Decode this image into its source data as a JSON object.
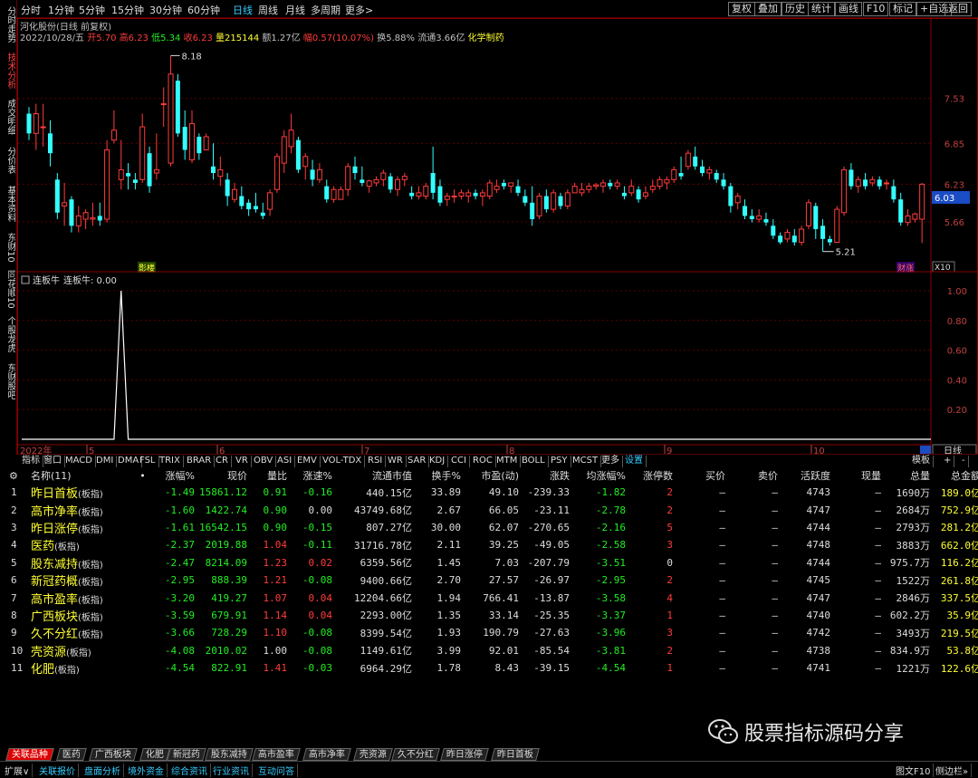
{
  "left_tabs": [
    "分时走势",
    "技术分析",
    "成交明细",
    "分价表",
    "基本资料",
    "东财10",
    "同花顺10",
    "个股龙虎",
    "东财股吧"
  ],
  "left_active": 1,
  "periods": [
    "分时",
    "1分钟",
    "5分钟",
    "15分钟",
    "30分钟",
    "60分钟",
    "日线",
    "周线",
    "月线",
    "多周期",
    "更多>"
  ],
  "period_active": 6,
  "right_buttons": [
    "复权",
    "叠加",
    "历史",
    "统计",
    "画线",
    "F10",
    "标记",
    "+自选",
    "返回"
  ],
  "info": {
    "name": "河化股份(日线 前复权)",
    "date": "2022/10/28/五",
    "open_label": "开",
    "open": "5.70",
    "high_label": "高",
    "high": "6.23",
    "low_label": "低",
    "low": "5.34",
    "close_label": "收",
    "close": "6.23",
    "vol_label": "量",
    "vol": "215144",
    "amt_label": "额",
    "amt": "1.27亿",
    "chg_label": "幅",
    "chg": "0.57(10.07%)",
    "turn_label": "换",
    "turn": "5.88%",
    "float_label": "流通",
    "float": "3.66亿",
    "concept": "化学制药"
  },
  "price_axis": [
    "7.53",
    "6.85",
    "6.23",
    "5.66"
  ],
  "price_current": "6.03",
  "high_mark": "8.18",
  "low_mark": "5.21",
  "tag_left": "影楼",
  "tag_right": "财涨",
  "zoom": "X10",
  "indicator": {
    "title": "连板牛",
    "value_text": "连板牛: 0.00",
    "axis": [
      "1.00",
      "0.80",
      "0.60",
      "0.40",
      "0.20"
    ]
  },
  "x_axis": [
    "2022年",
    "5",
    "6",
    "7",
    "8",
    "9",
    "10"
  ],
  "day_tab": "日线",
  "idx_tabs": [
    "指标",
    "窗口",
    "MACD",
    "DMI",
    "DMA",
    "FSL",
    "TRIX",
    "BRAR",
    "CR",
    "VR",
    "OBV",
    "ASI",
    "EMV",
    "VOL-TDX",
    "RSI",
    "WR",
    "SAR",
    "KDJ",
    "CCI",
    "ROC",
    "MTM",
    "BOLL",
    "PSY",
    "MCST",
    "更多",
    "设置"
  ],
  "idx_right": [
    "模板",
    "+",
    "-"
  ],
  "table": {
    "headers": [
      "名称(11)",
      "•",
      "涨幅%",
      "现价",
      "量比",
      "涨速%",
      "流通市值",
      "换手%",
      "市盈(动)",
      "涨跌",
      "均涨幅%",
      "涨停数",
      "买价",
      "卖价",
      "活跃度",
      "现量",
      "总量",
      "总金额"
    ],
    "rows": [
      [
        "1",
        "昨日首板",
        "-1.49",
        "15861.12",
        "0.91",
        "-0.16",
        "440.15亿",
        "33.89",
        "49.10",
        "-239.33",
        "-1.82",
        "2",
        "—",
        "—",
        "4743",
        "—",
        "1690万",
        "189.0亿"
      ],
      [
        "2",
        "高市净率",
        "-1.60",
        "1422.74",
        "0.90",
        "0.00",
        "43749.68亿",
        "2.67",
        "66.05",
        "-23.11",
        "-2.78",
        "2",
        "—",
        "—",
        "4747",
        "—",
        "2684万",
        "752.9亿"
      ],
      [
        "3",
        "昨日涨停",
        "-1.61",
        "16542.15",
        "0.90",
        "-0.15",
        "807.27亿",
        "30.00",
        "62.07",
        "-270.65",
        "-2.16",
        "5",
        "—",
        "—",
        "4744",
        "—",
        "2793万",
        "281.2亿"
      ],
      [
        "4",
        "医药",
        "-2.37",
        "2019.88",
        "1.04",
        "-0.11",
        "31716.78亿",
        "2.11",
        "39.25",
        "-49.05",
        "-2.58",
        "3",
        "—",
        "—",
        "4748",
        "—",
        "3883万",
        "662.0亿"
      ],
      [
        "5",
        "股东减持",
        "-2.47",
        "8214.09",
        "1.23",
        "0.02",
        "6359.56亿",
        "1.45",
        "7.03",
        "-207.79",
        "-3.51",
        "0",
        "—",
        "—",
        "4744",
        "—",
        "975.7万",
        "116.2亿"
      ],
      [
        "6",
        "新冠药概",
        "-2.95",
        "888.39",
        "1.21",
        "-0.08",
        "9400.66亿",
        "2.70",
        "27.57",
        "-26.97",
        "-2.95",
        "2",
        "—",
        "—",
        "4745",
        "—",
        "1522万",
        "261.8亿"
      ],
      [
        "7",
        "高市盈率",
        "-3.20",
        "419.27",
        "1.07",
        "0.04",
        "12204.66亿",
        "1.94",
        "766.41",
        "-13.87",
        "-3.58",
        "4",
        "—",
        "—",
        "4747",
        "—",
        "2846万",
        "337.5亿"
      ],
      [
        "8",
        "广西板块",
        "-3.59",
        "679.91",
        "1.14",
        "0.04",
        "2293.00亿",
        "1.35",
        "33.14",
        "-25.35",
        "-3.37",
        "1",
        "—",
        "—",
        "4740",
        "—",
        "602.2万",
        "35.9亿"
      ],
      [
        "9",
        "久不分红",
        "-3.66",
        "728.29",
        "1.10",
        "-0.08",
        "8399.54亿",
        "1.93",
        "190.79",
        "-27.63",
        "-3.96",
        "3",
        "—",
        "—",
        "4742",
        "—",
        "3493万",
        "219.5亿"
      ],
      [
        "10",
        "壳资源",
        "-4.08",
        "2010.02",
        "1.00",
        "-0.08",
        "1149.61亿",
        "3.99",
        "92.01",
        "-85.54",
        "-3.81",
        "2",
        "—",
        "—",
        "4738",
        "—",
        "834.9万",
        "53.8亿"
      ],
      [
        "11",
        "化肥",
        "-4.54",
        "822.91",
        "1.41",
        "-0.03",
        "6964.29亿",
        "1.78",
        "8.43",
        "-39.15",
        "-4.54",
        "1",
        "—",
        "—",
        "4741",
        "—",
        "1221万",
        "122.6亿"
      ]
    ],
    "suffix": "(板指)"
  },
  "bottom_tabs": [
    "关联品种",
    "医药",
    "广西板块",
    "化肥",
    "新冠药",
    "股东减持",
    "高市盈率",
    "高市净率",
    "壳资源",
    "久不分红",
    "昨日涨停",
    "昨日首板"
  ],
  "status_items": [
    "扩展∨",
    "关联报价",
    "盘面分析",
    "境外资金",
    "综合资讯",
    "行业资讯",
    "互动问答"
  ],
  "status_right": [
    "图文F10",
    "侧边栏»"
  ],
  "watermark": "股票指标源码分享",
  "colors": {
    "up": "#ff3b3b",
    "down": "#33ffff",
    "bg": "#000000",
    "accent": "#33ccff"
  },
  "chart_data": {
    "type": "candlestick",
    "ohlc": [
      [
        7.3,
        7.4,
        6.9,
        7.0
      ],
      [
        7.0,
        7.45,
        6.75,
        7.3
      ],
      [
        7.1,
        7.45,
        6.8,
        7.1
      ],
      [
        7.0,
        7.2,
        6.5,
        6.7
      ],
      [
        6.3,
        6.4,
        5.7,
        5.8
      ],
      [
        5.9,
        6.25,
        5.6,
        5.95
      ],
      [
        6.0,
        6.05,
        5.5,
        5.6
      ],
      [
        5.6,
        5.9,
        5.5,
        5.75
      ],
      [
        5.7,
        5.85,
        5.55,
        5.8
      ],
      [
        5.7,
        5.95,
        5.6,
        5.72
      ],
      [
        5.75,
        5.95,
        5.6,
        5.68
      ],
      [
        5.7,
        6.9,
        5.65,
        6.75
      ],
      [
        6.9,
        7.35,
        6.85,
        7.05
      ],
      [
        6.3,
        6.9,
        6.15,
        6.45
      ],
      [
        6.4,
        6.55,
        6.15,
        6.35
      ],
      [
        6.3,
        6.4,
        6.15,
        6.25
      ],
      [
        6.3,
        7.3,
        6.25,
        7.1
      ],
      [
        6.7,
        6.8,
        6.1,
        6.2
      ],
      [
        6.4,
        7.0,
        6.3,
        6.45
      ],
      [
        7.45,
        7.7,
        7.1,
        7.45
      ],
      [
        6.55,
        8.18,
        6.5,
        7.9
      ],
      [
        7.8,
        7.9,
        6.95,
        7.0
      ],
      [
        7.1,
        7.35,
        6.6,
        6.75
      ],
      [
        6.6,
        7.35,
        6.55,
        7.15
      ],
      [
        6.95,
        7.0,
        6.6,
        6.7
      ],
      [
        6.75,
        7.0,
        6.75,
        6.95
      ],
      [
        6.5,
        6.85,
        6.3,
        6.4
      ],
      [
        6.35,
        6.65,
        6.2,
        6.45
      ],
      [
        6.3,
        6.4,
        5.9,
        6.05
      ],
      [
        6.0,
        6.25,
        5.95,
        6.15
      ],
      [
        6.05,
        6.2,
        5.85,
        5.9
      ],
      [
        5.95,
        6.0,
        5.75,
        5.85
      ],
      [
        5.9,
        6.1,
        5.8,
        5.85
      ],
      [
        5.8,
        5.95,
        5.7,
        5.75
      ],
      [
        5.85,
        6.15,
        5.75,
        6.1
      ],
      [
        6.15,
        6.7,
        6.1,
        6.65
      ],
      [
        6.55,
        7.05,
        6.4,
        6.95
      ],
      [
        6.8,
        7.3,
        6.7,
        7.05
      ],
      [
        6.9,
        6.95,
        6.4,
        6.45
      ],
      [
        6.5,
        6.7,
        6.3,
        6.65
      ],
      [
        6.45,
        6.6,
        6.2,
        6.3
      ],
      [
        6.3,
        6.55,
        6.25,
        6.45
      ],
      [
        6.2,
        6.3,
        5.95,
        6.0
      ],
      [
        6.0,
        6.2,
        5.95,
        6.15
      ],
      [
        6.0,
        6.2,
        6.0,
        6.15
      ],
      [
        6.15,
        6.55,
        6.05,
        6.5
      ],
      [
        6.5,
        6.65,
        6.3,
        6.4
      ],
      [
        6.3,
        6.5,
        6.2,
        6.25
      ],
      [
        6.2,
        6.3,
        6.1,
        6.28
      ],
      [
        6.25,
        6.35,
        6.2,
        6.3
      ],
      [
        6.3,
        6.45,
        6.2,
        6.4
      ],
      [
        6.35,
        6.4,
        6.1,
        6.15
      ],
      [
        6.15,
        6.35,
        6.05,
        6.3
      ],
      [
        6.3,
        6.4,
        6.2,
        6.35
      ],
      [
        6.1,
        6.2,
        6.0,
        6.05
      ],
      [
        6.05,
        6.2,
        6.0,
        6.1
      ],
      [
        6.05,
        6.25,
        6.0,
        6.2
      ],
      [
        6.4,
        6.8,
        6.0,
        6.1
      ],
      [
        6.2,
        6.3,
        5.9,
        5.95
      ],
      [
        6.0,
        6.1,
        5.9,
        6.05
      ],
      [
        6.05,
        6.15,
        5.95,
        6.05
      ],
      [
        6.05,
        6.15,
        6.0,
        6.1
      ],
      [
        6.05,
        6.15,
        5.95,
        6.1
      ],
      [
        6.1,
        6.15,
        6.0,
        6.05
      ],
      [
        6.05,
        6.15,
        5.9,
        6.1
      ],
      [
        6.05,
        6.3,
        6.0,
        6.25
      ],
      [
        6.15,
        6.3,
        6.1,
        6.2
      ],
      [
        6.25,
        6.3,
        6.15,
        6.2
      ],
      [
        6.2,
        6.25,
        6.1,
        6.25
      ],
      [
        6.2,
        6.3,
        6.05,
        6.1
      ],
      [
        6.05,
        6.15,
        5.9,
        5.95
      ],
      [
        5.95,
        6.2,
        5.6,
        5.7
      ],
      [
        5.75,
        6.1,
        5.7,
        6.05
      ],
      [
        6.05,
        6.15,
        5.8,
        5.85
      ],
      [
        5.85,
        6.15,
        5.8,
        6.1
      ],
      [
        6.05,
        6.1,
        5.85,
        5.9
      ],
      [
        5.9,
        6.15,
        5.85,
        6.1
      ],
      [
        6.1,
        6.25,
        6.1,
        6.2
      ],
      [
        6.1,
        6.25,
        6.05,
        6.15
      ],
      [
        6.15,
        6.25,
        6.1,
        6.2
      ],
      [
        6.2,
        6.25,
        6.15,
        6.22
      ],
      [
        6.2,
        6.3,
        6.1,
        6.25
      ],
      [
        6.25,
        6.3,
        6.15,
        6.2
      ],
      [
        6.2,
        6.3,
        6.15,
        6.25
      ],
      [
        6.1,
        6.2,
        6.0,
        6.05
      ],
      [
        6.1,
        6.3,
        6.05,
        6.2
      ],
      [
        6.15,
        6.2,
        5.95,
        6.0
      ],
      [
        6.05,
        6.2,
        6.0,
        6.1
      ],
      [
        6.15,
        6.3,
        6.1,
        6.2
      ],
      [
        6.2,
        6.35,
        6.15,
        6.3
      ],
      [
        6.25,
        6.35,
        6.15,
        6.3
      ],
      [
        6.3,
        6.5,
        6.25,
        6.45
      ],
      [
        6.4,
        6.65,
        6.3,
        6.35
      ],
      [
        6.5,
        6.75,
        6.45,
        6.7
      ],
      [
        6.65,
        6.8,
        6.45,
        6.5
      ],
      [
        6.5,
        6.6,
        6.35,
        6.4
      ],
      [
        6.4,
        6.5,
        6.3,
        6.45
      ],
      [
        6.4,
        6.45,
        6.25,
        6.3
      ],
      [
        6.3,
        6.4,
        6.15,
        6.2
      ],
      [
        6.2,
        6.25,
        5.8,
        5.9
      ],
      [
        5.95,
        6.1,
        5.85,
        6.05
      ],
      [
        5.9,
        6.0,
        5.7,
        5.75
      ],
      [
        5.75,
        5.85,
        5.65,
        5.7
      ],
      [
        5.7,
        5.85,
        5.65,
        5.75
      ],
      [
        5.7,
        5.8,
        5.6,
        5.65
      ],
      [
        5.6,
        5.7,
        5.4,
        5.45
      ],
      [
        5.45,
        5.5,
        5.32,
        5.35
      ],
      [
        5.4,
        5.55,
        5.35,
        5.5
      ],
      [
        5.45,
        5.55,
        5.3,
        5.35
      ],
      [
        5.35,
        5.6,
        5.3,
        5.55
      ],
      [
        5.6,
        6.0,
        5.55,
        5.95
      ],
      [
        5.9,
        5.95,
        5.4,
        5.55
      ],
      [
        5.6,
        5.7,
        5.21,
        5.4
      ],
      [
        5.4,
        5.45,
        5.3,
        5.35
      ],
      [
        5.35,
        5.9,
        5.35,
        5.85
      ],
      [
        5.8,
        6.5,
        5.75,
        6.45
      ],
      [
        6.45,
        6.55,
        6.15,
        6.2
      ],
      [
        6.2,
        6.35,
        6.1,
        6.3
      ],
      [
        6.3,
        6.4,
        6.15,
        6.2
      ],
      [
        6.25,
        6.35,
        6.2,
        6.3
      ],
      [
        6.3,
        6.35,
        6.15,
        6.2
      ],
      [
        6.25,
        6.3,
        6.15,
        6.25
      ],
      [
        6.2,
        6.3,
        5.95,
        6.0
      ],
      [
        6.0,
        6.1,
        5.6,
        5.65
      ],
      [
        5.65,
        5.85,
        5.6,
        5.75
      ],
      [
        5.7,
        5.8,
        5.65,
        5.78
      ],
      [
        5.7,
        6.25,
        5.34,
        6.23
      ]
    ],
    "price_range": [
      5.0,
      8.35
    ],
    "indicator_series_peak_index": 13,
    "indicator_range": [
      0,
      1.0
    ]
  }
}
